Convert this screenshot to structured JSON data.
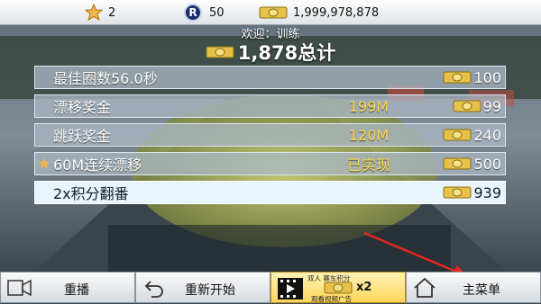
{
  "topbar": {
    "stars": "2",
    "tokens": "50",
    "tokens_icon": "R",
    "credits": "1,999,978,878"
  },
  "header": {
    "welcome": "欢迎：训练",
    "total": "1,878总计"
  },
  "rows": [
    {
      "label": "最佳圈数56.0秒",
      "middle": "",
      "value": "100",
      "starred": false
    },
    {
      "label": "漂移奖金",
      "middle": "199M",
      "value": "99",
      "starred": false
    },
    {
      "label": "跳跃奖金",
      "middle": "120M",
      "value": "240",
      "starred": false
    },
    {
      "label": "60M连续漂移",
      "middle": "已实现",
      "value": "500",
      "starred": true
    },
    {
      "label": "2x积分翻番",
      "middle": "",
      "value": "939",
      "starred": false
    }
  ],
  "bottom": {
    "replay": "重播",
    "restart": "重新开始",
    "video_top": "双人 赛车积分",
    "video_mult": "x2",
    "video_bottom": "观看视频广告",
    "main_menu": "主菜单"
  },
  "colors": {
    "accent_yellow": "#ffd84a",
    "annotation_arrow": "#e8261f",
    "row_bg": "#aab6c3",
    "final_row_bg": "#e9f5fd"
  }
}
